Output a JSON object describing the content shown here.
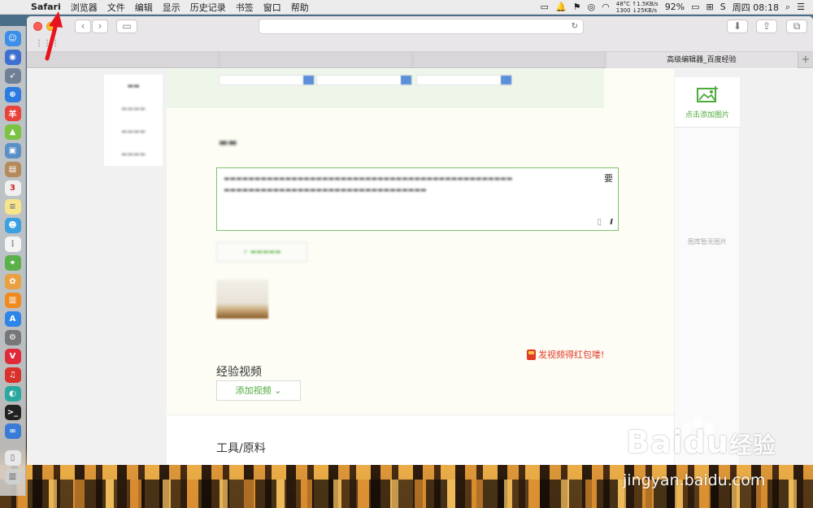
{
  "menubar": {
    "app_name": "Safari",
    "items": [
      "浏览器",
      "文件",
      "编辑",
      "显示",
      "历史记录",
      "书签",
      "窗口",
      "帮助"
    ],
    "temp": "48°C",
    "rpm": "1300",
    "up_speed": "↑1.5KB/s",
    "down_speed": "↓25KB/s",
    "battery": "92%",
    "clock": "周四 08:18"
  },
  "browser": {
    "tabs": [
      {
        "label": "",
        "active": false
      },
      {
        "label": "",
        "active": false
      },
      {
        "label": "",
        "active": false
      },
      {
        "label": "高级编辑器_百度经验",
        "active": true
      }
    ],
    "new_tab": "+"
  },
  "editor": {
    "video_section_title": "经验视频",
    "hongbao_text": "发视频得红包喽!",
    "add_video_label": "添加视频",
    "add_video_caret": "⌄",
    "tools_section_title": "工具/原料",
    "editor_tail_char": "要",
    "italic_icon": "I"
  },
  "right_panel": {
    "add_image_label": "点击添加图片",
    "empty_text": "图库暂无图片"
  },
  "watermark": {
    "brand": "Baidu",
    "jingyan": "经验",
    "url": "jingyan.baidu.com"
  },
  "colors": {
    "accent_green": "#4caa3a",
    "hongbao_red": "#e23b2a",
    "annotation_red": "#e8141d"
  }
}
